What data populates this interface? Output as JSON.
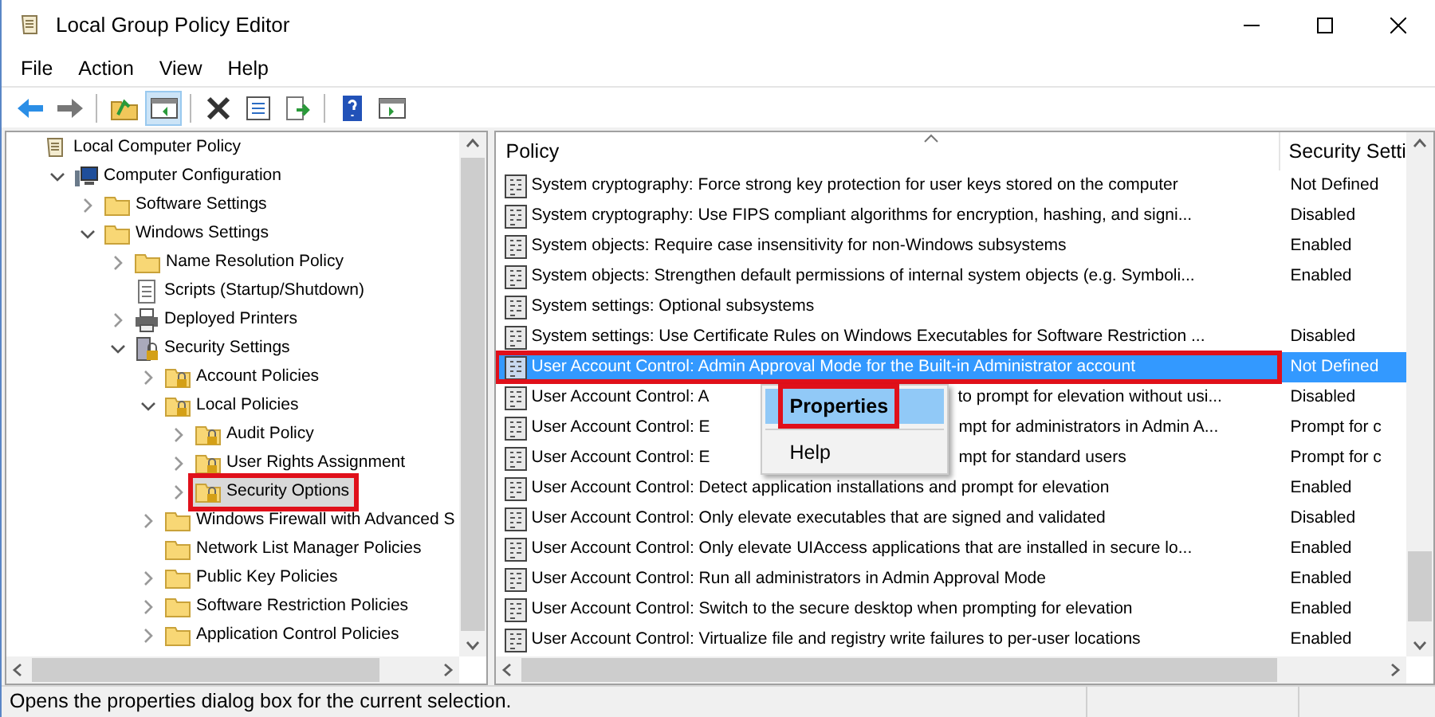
{
  "window": {
    "title": "Local Group Policy Editor"
  },
  "menu": [
    "File",
    "Action",
    "View",
    "Help"
  ],
  "toolbar": [
    {
      "kind": "back",
      "pressed": false
    },
    {
      "kind": "forward",
      "pressed": false
    },
    {
      "kind": "sep"
    },
    {
      "kind": "up",
      "pressed": false
    },
    {
      "kind": "tree",
      "pressed": true
    },
    {
      "kind": "sep"
    },
    {
      "kind": "delete",
      "pressed": false
    },
    {
      "kind": "properties",
      "pressed": false
    },
    {
      "kind": "export",
      "pressed": false
    },
    {
      "kind": "sep"
    },
    {
      "kind": "help",
      "pressed": false
    },
    {
      "kind": "pane",
      "pressed": false
    }
  ],
  "tree": [
    {
      "label": "Local Computer Policy",
      "kind": "policy",
      "selected": false,
      "children": [
        {
          "label": "Computer Configuration",
          "kind": "computer",
          "expanded": true,
          "selected": false,
          "children": [
            {
              "label": "Software Settings",
              "kind": "folder",
              "expanded": false,
              "selected": false
            },
            {
              "label": "Windows Settings",
              "kind": "folder",
              "expanded": true,
              "selected": false,
              "children": [
                {
                  "label": "Name Resolution Policy",
                  "kind": "folder",
                  "expanded": false,
                  "selected": false
                },
                {
                  "label": "Scripts (Startup/Shutdown)",
                  "kind": "script",
                  "selected": false
                },
                {
                  "label": "Deployed Printers",
                  "kind": "printer",
                  "expanded": false,
                  "selected": false
                },
                {
                  "label": "Security Settings",
                  "kind": "secure",
                  "expanded": true,
                  "selected": false,
                  "children": [
                    {
                      "label": "Account Policies",
                      "kind": "lockfolder",
                      "expanded": false,
                      "selected": false
                    },
                    {
                      "label": "Local Policies",
                      "kind": "lockfolder",
                      "expanded": true,
                      "selected": false,
                      "children": [
                        {
                          "label": "Audit Policy",
                          "kind": "lockfolder",
                          "expanded": false,
                          "selected": false
                        },
                        {
                          "label": "User Rights Assignment",
                          "kind": "lockfolder",
                          "expanded": false,
                          "selected": false
                        },
                        {
                          "label": "Security Options",
                          "kind": "lockfolder",
                          "expanded": false,
                          "selected": true,
                          "annotated": true
                        }
                      ]
                    },
                    {
                      "label": "Windows Firewall with Advanced S",
                      "kind": "folder",
                      "expanded": false,
                      "selected": false
                    },
                    {
                      "label": "Network List Manager Policies",
                      "kind": "folder",
                      "selected": false
                    },
                    {
                      "label": "Public Key Policies",
                      "kind": "folder",
                      "expanded": false,
                      "selected": false
                    },
                    {
                      "label": "Software Restriction Policies",
                      "kind": "folder",
                      "expanded": false,
                      "selected": false
                    },
                    {
                      "label": "Application Control Policies",
                      "kind": "folder",
                      "expanded": false,
                      "selected": false
                    }
                  ]
                }
              ]
            }
          ]
        }
      ]
    }
  ],
  "table": {
    "columns": [
      "Policy",
      "Security Setti"
    ],
    "rows": [
      {
        "policy": "System cryptography: Force strong key protection for user keys stored on the computer",
        "setting": "Not Defined",
        "selected": false
      },
      {
        "policy": "System cryptography: Use FIPS compliant algorithms for encryption, hashing, and signi...",
        "setting": "Disabled",
        "selected": false
      },
      {
        "policy": "System objects: Require case insensitivity for non-Windows subsystems",
        "setting": "Enabled",
        "selected": false
      },
      {
        "policy": "System objects: Strengthen default permissions of internal system objects (e.g. Symboli...",
        "setting": "Enabled",
        "selected": false
      },
      {
        "policy": "System settings: Optional subsystems",
        "selected": false
      },
      {
        "policy": "System settings: Use Certificate Rules on Windows Executables for Software Restriction ...",
        "setting": "Disabled",
        "selected": false
      },
      {
        "policy": "User Account Control: Admin Approval Mode for the Built-in Administrator account",
        "setting": "Not Defined",
        "selected": true,
        "annotated": true
      },
      {
        "policy": "User Account Control: A",
        "policy_tail": "to prompt for elevation without usi...",
        "setting": "Disabled",
        "selected": false
      },
      {
        "policy": "User Account Control: E",
        "policy_tail": "mpt for administrators in Admin A...",
        "setting": "Prompt for c",
        "selected": false
      },
      {
        "policy": "User Account Control: E",
        "policy_tail": "mpt for standard users",
        "setting": "Prompt for c",
        "selected": false
      },
      {
        "policy": "User Account Control: Detect application installations and prompt for elevation",
        "setting": "Enabled",
        "selected": false
      },
      {
        "policy": "User Account Control: Only elevate executables that are signed and validated",
        "setting": "Disabled",
        "selected": false
      },
      {
        "policy": "User Account Control: Only elevate UIAccess applications that are installed in secure lo...",
        "setting": "Enabled",
        "selected": false
      },
      {
        "policy": "User Account Control: Run all administrators in Admin Approval Mode",
        "setting": "Enabled",
        "selected": false
      },
      {
        "policy": "User Account Control: Switch to the secure desktop when prompting for elevation",
        "setting": "Enabled",
        "selected": false
      },
      {
        "policy": "User Account Control: Virtualize file and registry write failures to per-user locations",
        "setting": "Enabled",
        "selected": false
      }
    ]
  },
  "context_menu": {
    "items": [
      {
        "label": "Properties",
        "kind": "item",
        "selected": true,
        "annotated": true
      },
      {
        "kind": "separator"
      },
      {
        "label": "Help",
        "kind": "item",
        "selected": false
      }
    ]
  },
  "status_bar": "Opens the properties dialog box for the current selection."
}
